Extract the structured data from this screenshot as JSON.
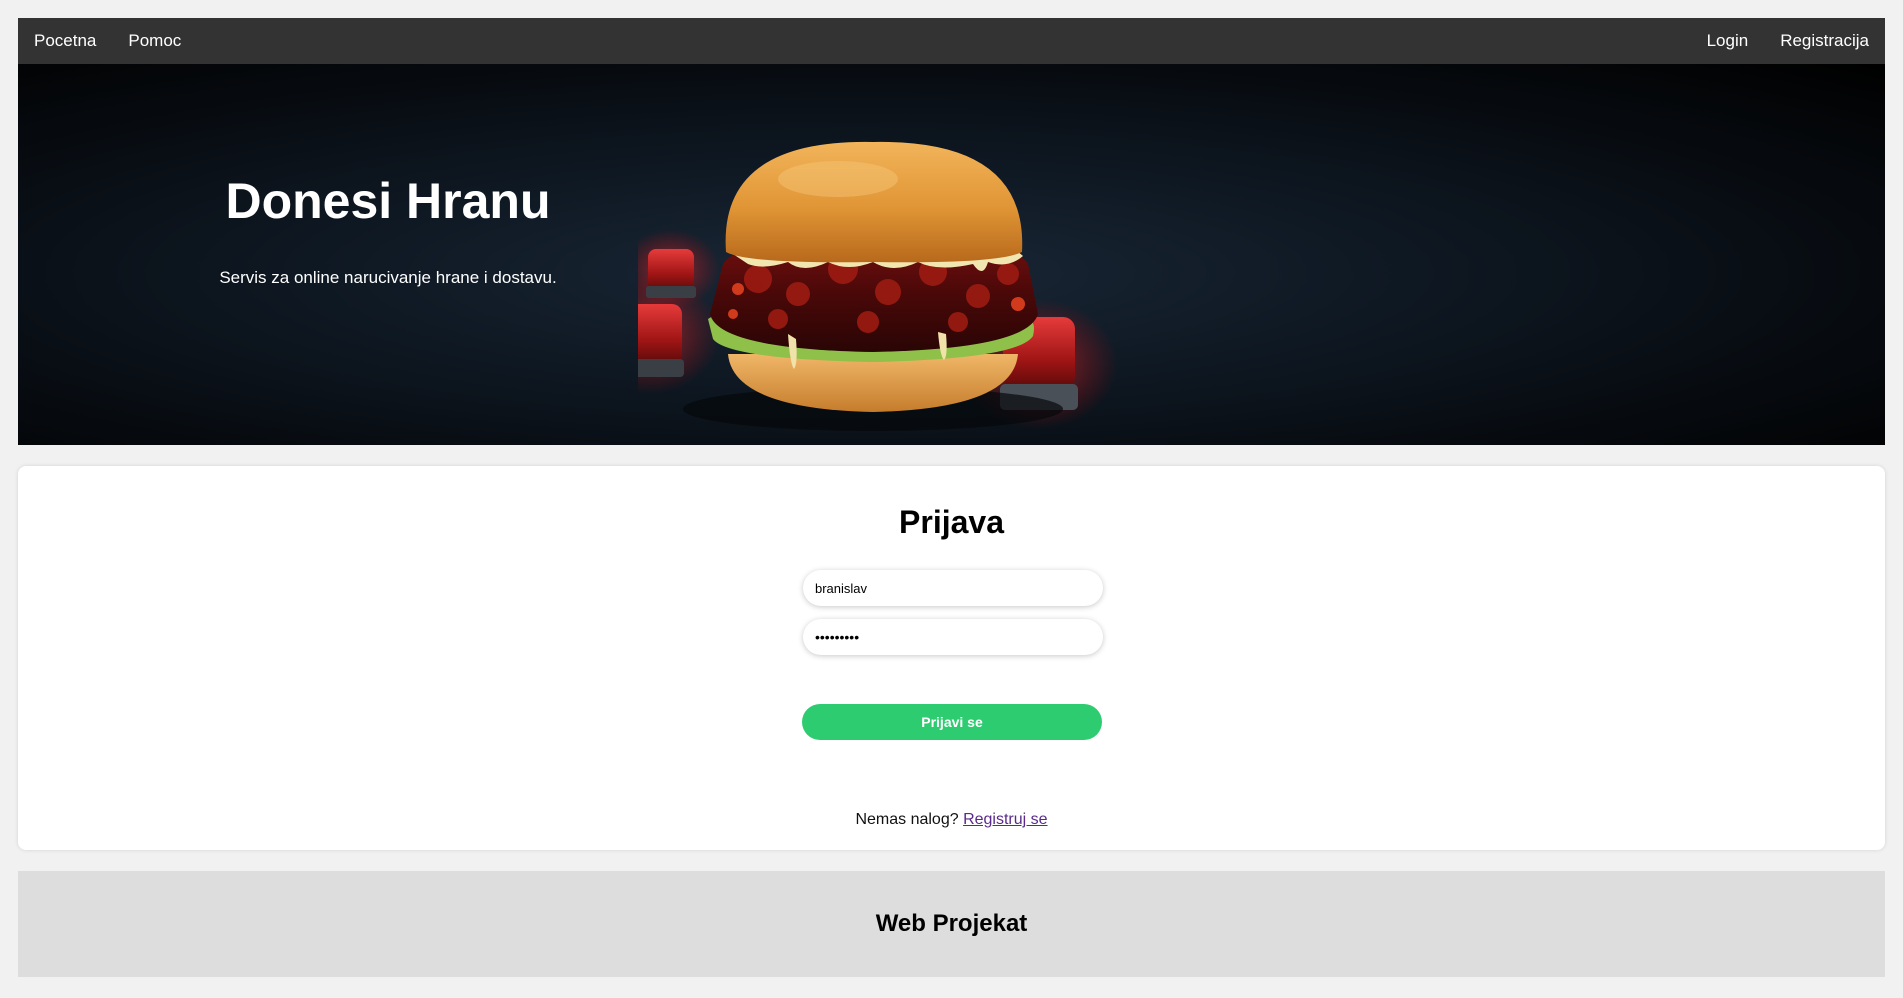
{
  "nav": {
    "left": [
      {
        "label": "Pocetna"
      },
      {
        "label": "Pomoc"
      }
    ],
    "right": [
      {
        "label": "Login"
      },
      {
        "label": "Registracija"
      }
    ]
  },
  "hero": {
    "title": "Donesi Hranu",
    "subtitle": "Servis za online narucivanje hrane i dostavu.",
    "image": "burger-with-red-siren-lights",
    "accent": "#0f1924"
  },
  "login": {
    "title": "Prijava",
    "username_value": "branislav",
    "password_value": "•••••••••",
    "submit_label": "Prijavi se",
    "submit_color": "#2ecc71",
    "register_prompt": "Nemas nalog?",
    "register_link": "Registruj se"
  },
  "footer": {
    "title": "Web Projekat"
  }
}
